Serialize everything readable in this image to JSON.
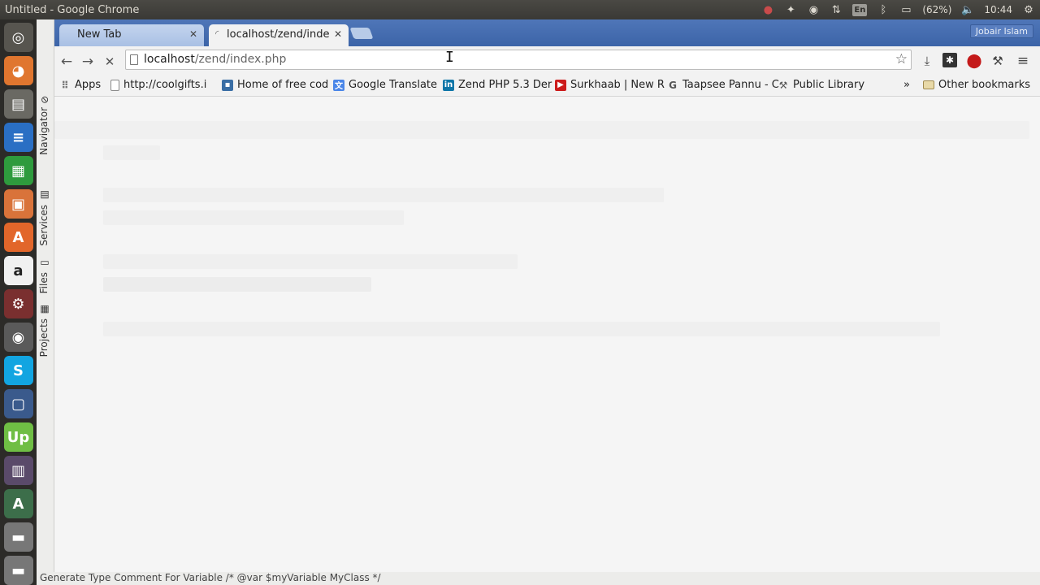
{
  "window_title": "Untitled - Google Chrome",
  "tray": {
    "battery": "(62%)",
    "time": "10:44"
  },
  "tabs": [
    {
      "label": "New Tab"
    },
    {
      "label": "localhost/zend/inde"
    }
  ],
  "profile_name": "Jobair Islam",
  "omnibox": {
    "host": "localhost",
    "path": "/zend/index.php"
  },
  "bookmarks": [
    {
      "label": "Apps",
      "icon": "apps-grid-icon",
      "color": "#777777"
    },
    {
      "label": "http://coolgifts.i",
      "icon": "page-icon",
      "color": "#888888"
    },
    {
      "label": "Home of free cod",
      "icon": "site-icon",
      "color": "#3a6ea5"
    },
    {
      "label": "Google Translate",
      "icon": "translate-icon",
      "color": "#4a86e8"
    },
    {
      "label": "Zend PHP 5.3 Der",
      "icon": "linkedin-icon",
      "color": "#0e76a8"
    },
    {
      "label": "Surkhaab | New R",
      "icon": "youtube-icon",
      "color": "#cc1b1b"
    },
    {
      "label": "Taapsee Pannu - C",
      "icon": "google-icon",
      "color": "#555555"
    },
    {
      "label": "Public Library",
      "icon": "library-icon",
      "color": "#555555"
    }
  ],
  "bookmarks_overflow": "»",
  "other_bookmarks": "Other bookmarks",
  "ide_tabs": [
    {
      "label": "Navigator"
    },
    {
      "label": "Services"
    },
    {
      "label": "Files"
    },
    {
      "label": "Projects"
    }
  ],
  "status_text": "Generate Type Comment For Variable /* @var $myVariable MyClass */"
}
